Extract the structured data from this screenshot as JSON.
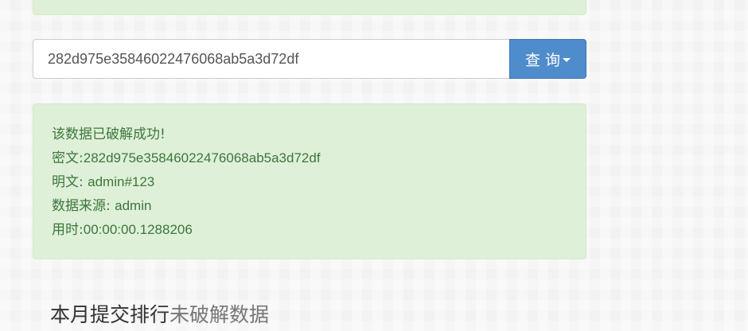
{
  "search": {
    "value": "282d975e35846022476068ab5a3d72df",
    "button_label": "查 询"
  },
  "result": {
    "status": "该数据已破解成功!",
    "cipher_label": "密文:",
    "cipher_value": "282d975e35846022476068ab5a3d72df",
    "plain_label": "明文: ",
    "plain_value": "admin#123",
    "source_label": "数据来源: ",
    "source_value": "admin",
    "time_label": "用时:",
    "time_value": "00:00:00.1288206"
  },
  "section": {
    "title_primary": "本月提交排行",
    "title_secondary": "未破解数据"
  }
}
